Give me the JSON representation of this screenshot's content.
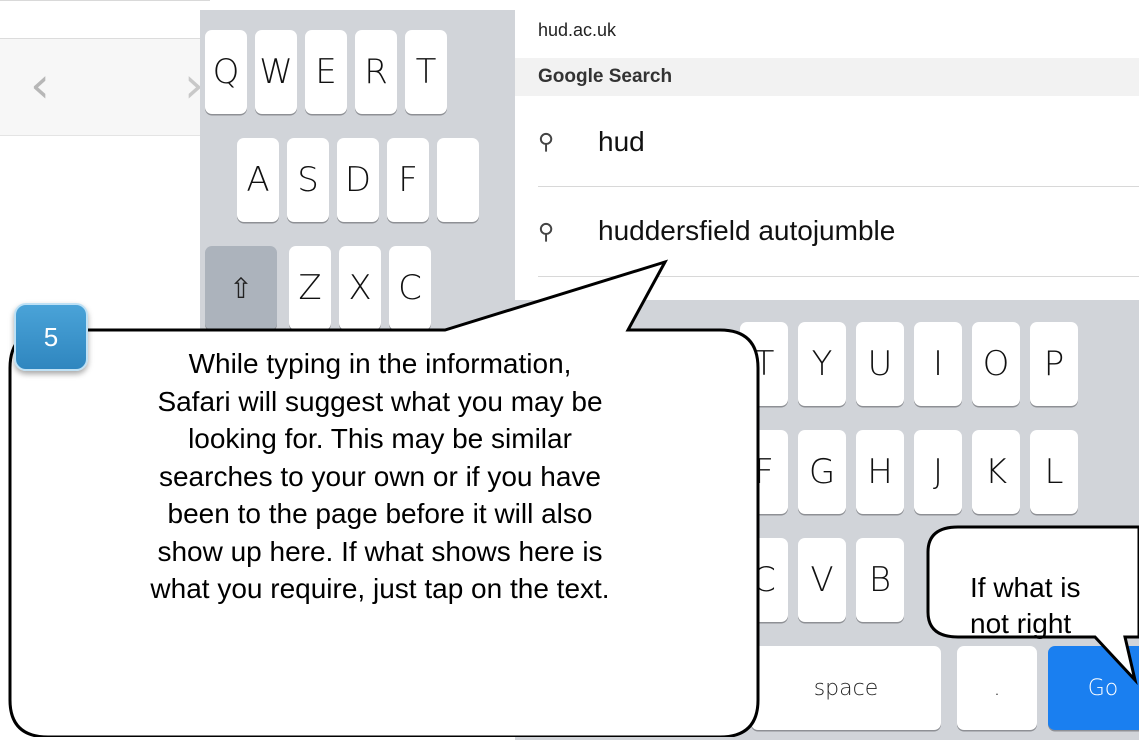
{
  "safari": {
    "back_icon": "chevron-left-icon",
    "forward_icon": "chevron-right-icon",
    "back_glyph": "‹",
    "forward_glyph": "›"
  },
  "suggestions": {
    "url": "hud.ac.uk",
    "section_title": "Google Search",
    "search_icon": "magnifier-icon",
    "items": [
      "hud",
      "huddersfield autojumble"
    ]
  },
  "keyboard_left": {
    "row1": [
      "Q",
      "W",
      "E",
      "R",
      "T"
    ],
    "row2": [
      "A",
      "S",
      "D",
      "F"
    ],
    "shift_glyph": "⇧",
    "row3": [
      "Z",
      "X",
      "C"
    ]
  },
  "keyboard_right": {
    "row1": [
      "T",
      "Y",
      "U",
      "I",
      "O",
      "P"
    ],
    "row2": [
      "F",
      "G",
      "H",
      "J",
      "K",
      "L"
    ],
    "row3": [
      "C",
      "V",
      "B"
    ],
    "space_label": "space",
    "period_label": ".",
    "go_label": "Go"
  },
  "callout": {
    "step_number": "5",
    "lines": [
      "While typing in the information,",
      "Safari will suggest what you may be",
      "looking for. This may be similar",
      "searches to your own or if you have",
      "been to the page before it will also",
      "show up here. If what shows here is",
      "what you require, just tap on the text."
    ],
    "badge_color": "#3a93cc"
  },
  "callout_secondary": {
    "lines": [
      "If what is",
      "not right"
    ]
  },
  "colors": {
    "go_button": "#1a7ff0",
    "keyboard_bg": "#d1d4d9"
  }
}
